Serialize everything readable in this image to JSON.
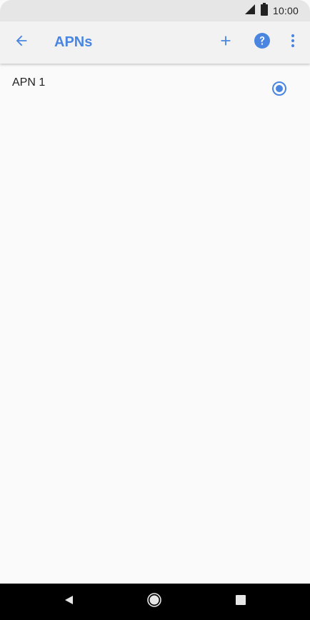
{
  "status_bar": {
    "time": "10:00",
    "icons": [
      "signal-icon",
      "battery-icon"
    ]
  },
  "app_bar": {
    "title": "APNs",
    "icons": [
      "back-arrow-icon",
      "plus-icon",
      "help-icon",
      "more-vert-icon"
    ]
  },
  "apn_list": [
    {
      "name": "APN 1",
      "selected": true
    }
  ],
  "nav_bar": {
    "icons": [
      "nav-back-icon",
      "nav-home-icon",
      "nav-recents-icon"
    ]
  },
  "colors": {
    "accent": "#4a86e0",
    "status_bar_bg": "#e6e6e6",
    "app_bar_bg": "#f2f2f2",
    "content_bg": "#fafafa",
    "nav_bar_bg": "#000000"
  }
}
